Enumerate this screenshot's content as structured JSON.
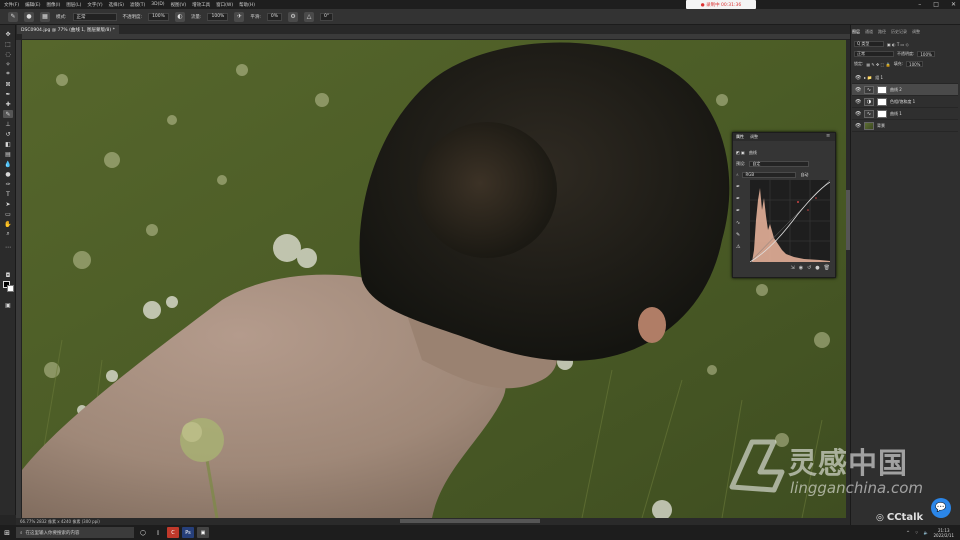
{
  "menubar": {
    "items": [
      "文件(F)",
      "编辑(E)",
      "图像(I)",
      "图层(L)",
      "文字(Y)",
      "选择(S)",
      "滤镜(T)",
      "3D(D)",
      "视图(V)",
      "增效工具",
      "窗口(W)",
      "帮助(H)"
    ],
    "recording": "● 录制中 00:31:36"
  },
  "options": {
    "mode_label": "模式:",
    "mode_value": "正常",
    "opacity_label": "不透明度:",
    "opacity_value": "100%",
    "flow_label": "流量:",
    "flow_value": "100%",
    "smooth_label": "平滑:",
    "smooth_value": "0%",
    "angle_value": "0°"
  },
  "document": {
    "tab_title": "DSC0904.jpg @ 77% (曲线 1, 图层蒙版/8) *",
    "status": "66.77%    2832 像素 x 4240 像素 (300 ppi)"
  },
  "layers_panel": {
    "tabs": [
      "图层",
      "通道",
      "路径",
      "历史记录",
      "调整"
    ],
    "kind_label": "Q 类型",
    "blend_mode": "正常",
    "opacity_label": "不透明度:",
    "opacity_value": "100%",
    "lock_label": "锁定:",
    "fill_label": "填充:",
    "fill_value": "100%",
    "layers": [
      {
        "name": "组 1",
        "type": "group"
      },
      {
        "name": "曲线 2",
        "type": "adjustment"
      },
      {
        "name": "色相/饱和度 1",
        "type": "adjustment"
      },
      {
        "name": "曲线 1",
        "type": "adjustment"
      },
      {
        "name": "背景",
        "type": "photo"
      }
    ]
  },
  "curves_panel": {
    "tabs": [
      "属性",
      "调整"
    ],
    "title": "曲线",
    "preset_label": "预设:",
    "preset_value": "自定",
    "channel_value": "RGB",
    "auto_label": "自动"
  },
  "taskbar": {
    "search_placeholder": "在这里输入你要搜索的内容",
    "time": "21:13",
    "date": "2022/2/11"
  },
  "watermark": {
    "brand": "灵感中国",
    "url": "lingganchina.com",
    "cctalk": "CCtalk"
  },
  "colors": {
    "curve_fill": "#f0b8a0",
    "accent": "#2b86e8"
  }
}
